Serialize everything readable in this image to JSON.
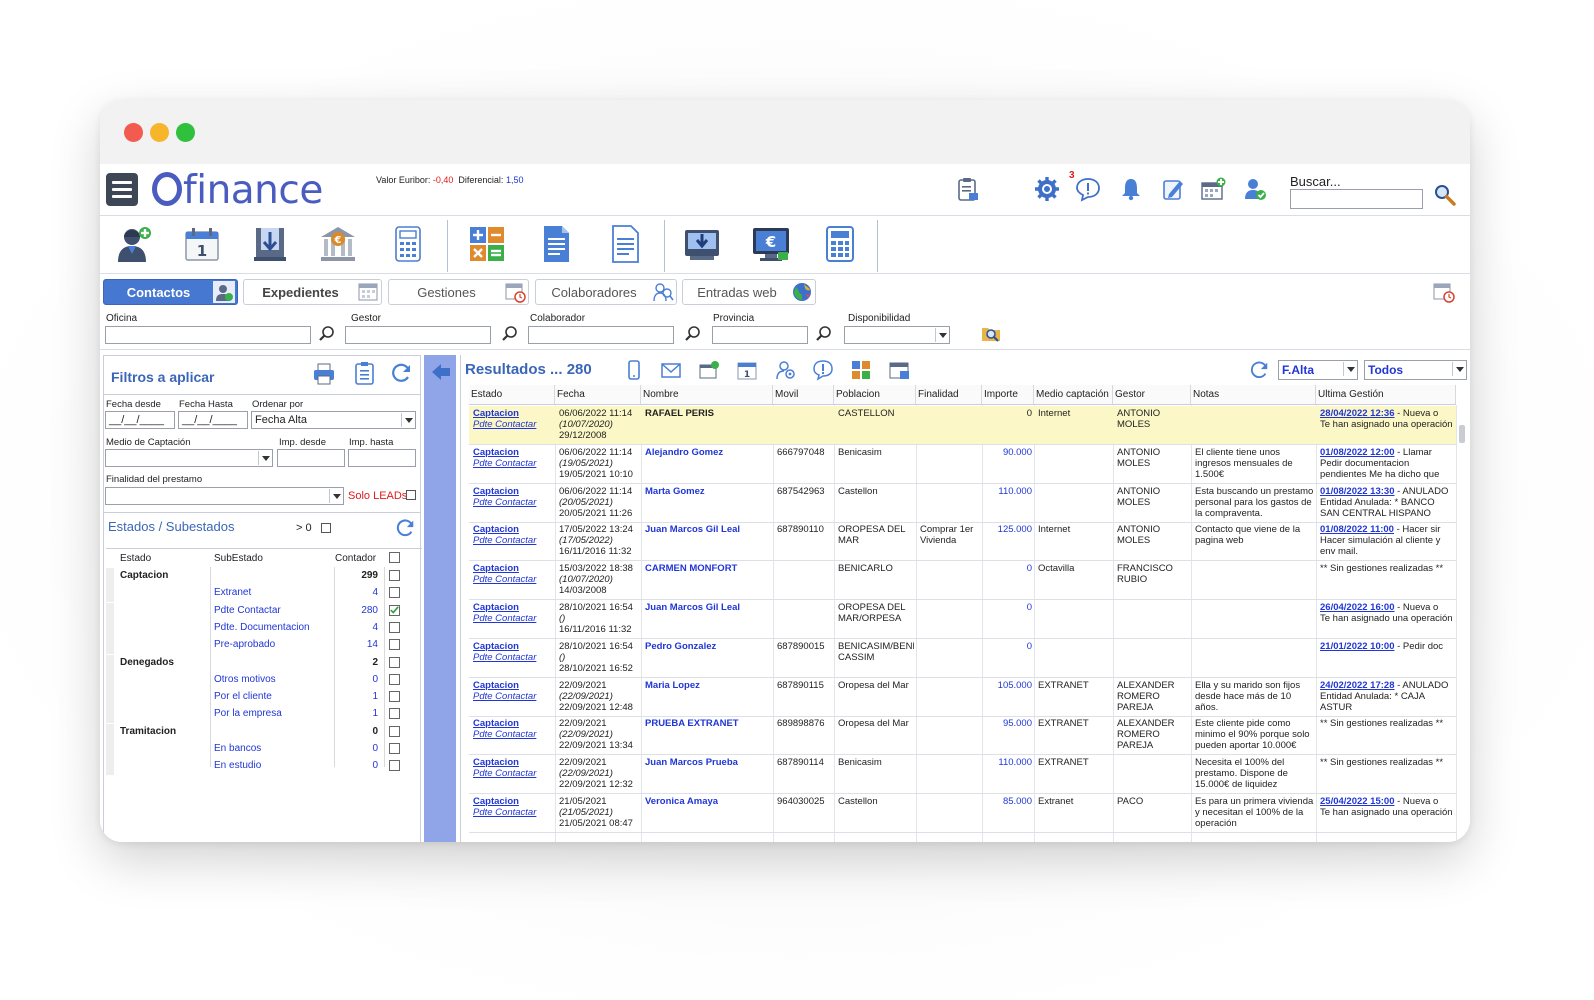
{
  "header": {
    "logo_text": "finance",
    "euribor_label": "Valor Euribor:",
    "euribor_value": "-0,40",
    "diferencial_label": "Diferencial:",
    "diferencial_value": "1,50",
    "notification_count": "3",
    "search_label": "Buscar...",
    "search_value": ""
  },
  "tabs": [
    {
      "label": "Contactos",
      "active": true,
      "icon": "contact-icon"
    },
    {
      "label": "Expedientes",
      "active": false,
      "icon": "folder-icon"
    },
    {
      "label": "Gestiones",
      "active": false,
      "icon": "calendar-clock-icon"
    },
    {
      "label": "Colaboradores",
      "active": false,
      "icon": "people-search-icon"
    },
    {
      "label": "Entradas web",
      "active": false,
      "icon": "globe-icon"
    }
  ],
  "filters": {
    "oficina_label": "Oficina",
    "gestor_label": "Gestor",
    "colaborador_label": "Colaborador",
    "provincia_label": "Provincia",
    "disponibilidad_label": "Disponibilidad"
  },
  "left_panel": {
    "title": "Filtros a aplicar",
    "fecha_desde_label": "Fecha desde",
    "fecha_desde_value": "__/__/____",
    "fecha_hasta_label": "Fecha Hasta",
    "fecha_hasta_value": "__/__/____",
    "ordenar_label": "Ordenar por",
    "ordenar_value": "Fecha Alta",
    "medio_label": "Medio de Captación",
    "imp_desde_label": "Imp. desde",
    "imp_hasta_label": "Imp. hasta",
    "finalidad_label": "Finalidad del prestamo",
    "solo_leads_label": "Solo LEADs",
    "estados_title": "Estados / Subestados",
    "gt_zero_label": "> 0",
    "col_estado": "Estado",
    "col_subestado": "SubEstado",
    "col_contador": "Contador",
    "rows": [
      {
        "cat": "Captacion",
        "sub": "",
        "num": "299",
        "bold": true,
        "checked": false
      },
      {
        "cat": "",
        "sub": "Extranet",
        "num": "4",
        "bold": false,
        "checked": false
      },
      {
        "cat": "",
        "sub": "Pdte Contactar",
        "num": "280",
        "bold": false,
        "checked": true
      },
      {
        "cat": "",
        "sub": "Pdte. Documentacion",
        "num": "4",
        "bold": false,
        "checked": false
      },
      {
        "cat": "",
        "sub": "Pre-aprobado",
        "num": "14",
        "bold": false,
        "checked": false
      },
      {
        "cat": "Denegados",
        "sub": "",
        "num": "2",
        "bold": true,
        "checked": false
      },
      {
        "cat": "",
        "sub": "Otros motivos",
        "num": "0",
        "bold": false,
        "checked": false
      },
      {
        "cat": "",
        "sub": "Por el cliente",
        "num": "1",
        "bold": false,
        "checked": false
      },
      {
        "cat": "",
        "sub": "Por la empresa",
        "num": "1",
        "bold": false,
        "checked": false
      },
      {
        "cat": "Tramitacion",
        "sub": "",
        "num": "0",
        "bold": true,
        "checked": false
      },
      {
        "cat": "",
        "sub": "En bancos",
        "num": "0",
        "bold": false,
        "checked": false
      },
      {
        "cat": "",
        "sub": "En estudio",
        "num": "0",
        "bold": false,
        "checked": false
      }
    ]
  },
  "results": {
    "title": "Resultados ... 280",
    "sort_value": "F.Alta",
    "filter_value": "Todos",
    "columns": [
      "Estado",
      "Fecha",
      "Nombre",
      "Movil",
      "Poblacion",
      "Finalidad",
      "Importe",
      "Medio captación",
      "Gestor",
      "Notas",
      "Ultima Gestión"
    ],
    "rows": [
      {
        "estado": "Captacion",
        "sub": "Pdte Contactar",
        "f1": "06/06/2022 11:14",
        "f2": "(10/07/2020)",
        "f3": "29/12/2008",
        "nombre": "RAFAEL PERIS",
        "nombre_blue": false,
        "movil": "",
        "poblacion": "CASTELLON",
        "finalidad": "",
        "importe": "0",
        "medio": "Internet",
        "gestor": "ANTONIO MOLES",
        "notas": "",
        "ug_date": "28/04/2022 12:36",
        "ug_text": " - Nueva o",
        "ug_line2": "Te han asignado una operación",
        "highlight": true
      },
      {
        "estado": "Captacion",
        "sub": "Pdte Contactar",
        "f1": "06/06/2022 11:14",
        "f2": "(19/05/2021)",
        "f3": "19/05/2021 10:10",
        "nombre": "Alejandro Gomez",
        "nombre_blue": true,
        "movil": "666797048",
        "poblacion": "Benicasim",
        "finalidad": "",
        "importe": "90.000",
        "medio": "",
        "gestor": "ANTONIO MOLES",
        "notas": "El cliente tiene unos ingresos mensuales de 1.500€",
        "ug_date": "01/08/2022 12:00",
        "ug_text": " - Llamar",
        "ug_line2": "Pedir documentacion pendientes Me ha dicho que me lo envia el ju",
        "highlight": false
      },
      {
        "estado": "Captacion",
        "sub": "Pdte Contactar",
        "f1": "06/06/2022 11:14",
        "f2": "(20/05/2021)",
        "f3": "20/05/2021 11:26",
        "nombre": "Marta Gomez",
        "nombre_blue": true,
        "movil": "687542963",
        "poblacion": "Castellon",
        "finalidad": "",
        "importe": "110.000",
        "medio": "",
        "gestor": "ANTONIO MOLES",
        "notas": "Esta buscando un prestamo personal para los gastos de la compraventa.",
        "ug_date": "01/08/2022 13:30",
        "ug_text": " - ANULADO",
        "ug_line2": "Entidad Anulada: * BANCO SAN CENTRAL HISPANO",
        "highlight": false
      },
      {
        "estado": "Captacion",
        "sub": "Pdte Contactar",
        "f1": "17/05/2022 13:24",
        "f2": "(17/05/2022)",
        "f3": "16/11/2016 11:32",
        "nombre": "Juan Marcos Gil Leal",
        "nombre_blue": true,
        "movil": "687890110",
        "poblacion": "OROPESA DEL MAR",
        "finalidad": "Comprar 1er Vivienda",
        "importe": "125.000",
        "medio": "Internet",
        "gestor": "ANTONIO MOLES",
        "notas": "Contacto que viene de la pagina web",
        "ug_date": "01/08/2022 11:00",
        "ug_text": " - Hacer sir",
        "ug_line2": "Hacer simulación al cliente y env mail.",
        "highlight": false
      },
      {
        "estado": "Captacion",
        "sub": "Pdte Contactar",
        "f1": "15/03/2022 18:38",
        "f2": "(10/07/2020)",
        "f3": "14/03/2008",
        "nombre": "CARMEN MONFORT",
        "nombre_blue": true,
        "movil": "",
        "poblacion": "BENICARLO",
        "finalidad": "",
        "importe": "0",
        "medio": "Octavilla",
        "gestor": "FRANCISCO RUBIO",
        "notas": "",
        "ug_date": "",
        "ug_text": "** Sin gestiones realizadas **",
        "ug_line2": "",
        "highlight": false
      },
      {
        "estado": "Captacion",
        "sub": "Pdte Contactar",
        "f1": "28/10/2021 16:54",
        "f2": "()",
        "f3": "16/11/2016 11:32",
        "nombre": "Juan Marcos Gil Leal",
        "nombre_blue": true,
        "movil": "",
        "poblacion": "OROPESA DEL MAR/ORPESA",
        "finalidad": "",
        "importe": "0",
        "medio": "",
        "gestor": "",
        "notas": "",
        "ug_date": "26/04/2022 16:00",
        "ug_text": " - Nueva o",
        "ug_line2": "Te han asignado una operación",
        "highlight": false
      },
      {
        "estado": "Captacion",
        "sub": "Pdte Contactar",
        "f1": "28/10/2021 16:54",
        "f2": "()",
        "f3": "28/10/2021 16:52",
        "nombre": "Pedro Gonzalez",
        "nombre_blue": true,
        "movil": "687890015",
        "poblacion": "BENICASIM/BENI CASSIM",
        "finalidad": "",
        "importe": "0",
        "medio": "",
        "gestor": "",
        "notas": "",
        "ug_date": "21/01/2022 10:00",
        "ug_text": " - Pedir doc",
        "ug_line2": "",
        "highlight": false
      },
      {
        "estado": "Captacion",
        "sub": "Pdte Contactar",
        "f1": "22/09/2021",
        "f2": "(22/09/2021)",
        "f3": "22/09/2021 12:48",
        "nombre": "Maria Lopez",
        "nombre_blue": true,
        "movil": "687890115",
        "poblacion": "Oropesa del Mar",
        "finalidad": "",
        "importe": "105.000",
        "medio": "EXTRANET",
        "gestor": "ALEXANDER ROMERO PAREJA",
        "notas": "Ella y su marido son fijos desde hace más de 10 años.",
        "ug_date": "24/02/2022 17:28",
        "ug_text": " - ANULADO",
        "ug_line2": "Entidad Anulada: * CAJA ASTUR",
        "highlight": false
      },
      {
        "estado": "Captacion",
        "sub": "Pdte Contactar",
        "f1": "22/09/2021",
        "f2": "(22/09/2021)",
        "f3": "22/09/2021 13:34",
        "nombre": "PRUEBA EXTRANET",
        "nombre_blue": true,
        "movil": "689898876",
        "poblacion": "Oropesa del Mar",
        "finalidad": "",
        "importe": "95.000",
        "medio": "EXTRANET",
        "gestor": "ALEXANDER ROMERO PAREJA",
        "notas": "Este cliente pide como minimo el 90% porque solo pueden aportar 10.000€",
        "ug_date": "",
        "ug_text": "** Sin gestiones realizadas **",
        "ug_line2": "",
        "highlight": false
      },
      {
        "estado": "Captacion",
        "sub": "Pdte Contactar",
        "f1": "22/09/2021",
        "f2": "(22/09/2021)",
        "f3": "22/09/2021 12:32",
        "nombre": "Juan Marcos Prueba",
        "nombre_blue": true,
        "movil": "687890114",
        "poblacion": "Benicasim",
        "finalidad": "",
        "importe": "110.000",
        "medio": "EXTRANET",
        "gestor": "",
        "notas": "Necesita el 100% del prestamo. Dispone de 15.000€ de liquidez",
        "ug_date": "",
        "ug_text": "** Sin gestiones realizadas **",
        "ug_line2": "",
        "highlight": false
      },
      {
        "estado": "Captacion",
        "sub": "Pdte Contactar",
        "f1": "21/05/2021",
        "f2": "(21/05/2021)",
        "f3": "21/05/2021 08:47",
        "nombre": "Veronica Amaya",
        "nombre_blue": true,
        "movil": "964030025",
        "poblacion": "Castellon",
        "finalidad": "",
        "importe": "85.000",
        "medio": "Extranet",
        "gestor": "PACO",
        "notas": "Es para un primera vivienda y necesitan el 100% de la operación",
        "ug_date": "25/04/2022 15:00",
        "ug_text": " - Nueva o",
        "ug_line2": "Te han asignado una operación",
        "highlight": false
      }
    ]
  }
}
